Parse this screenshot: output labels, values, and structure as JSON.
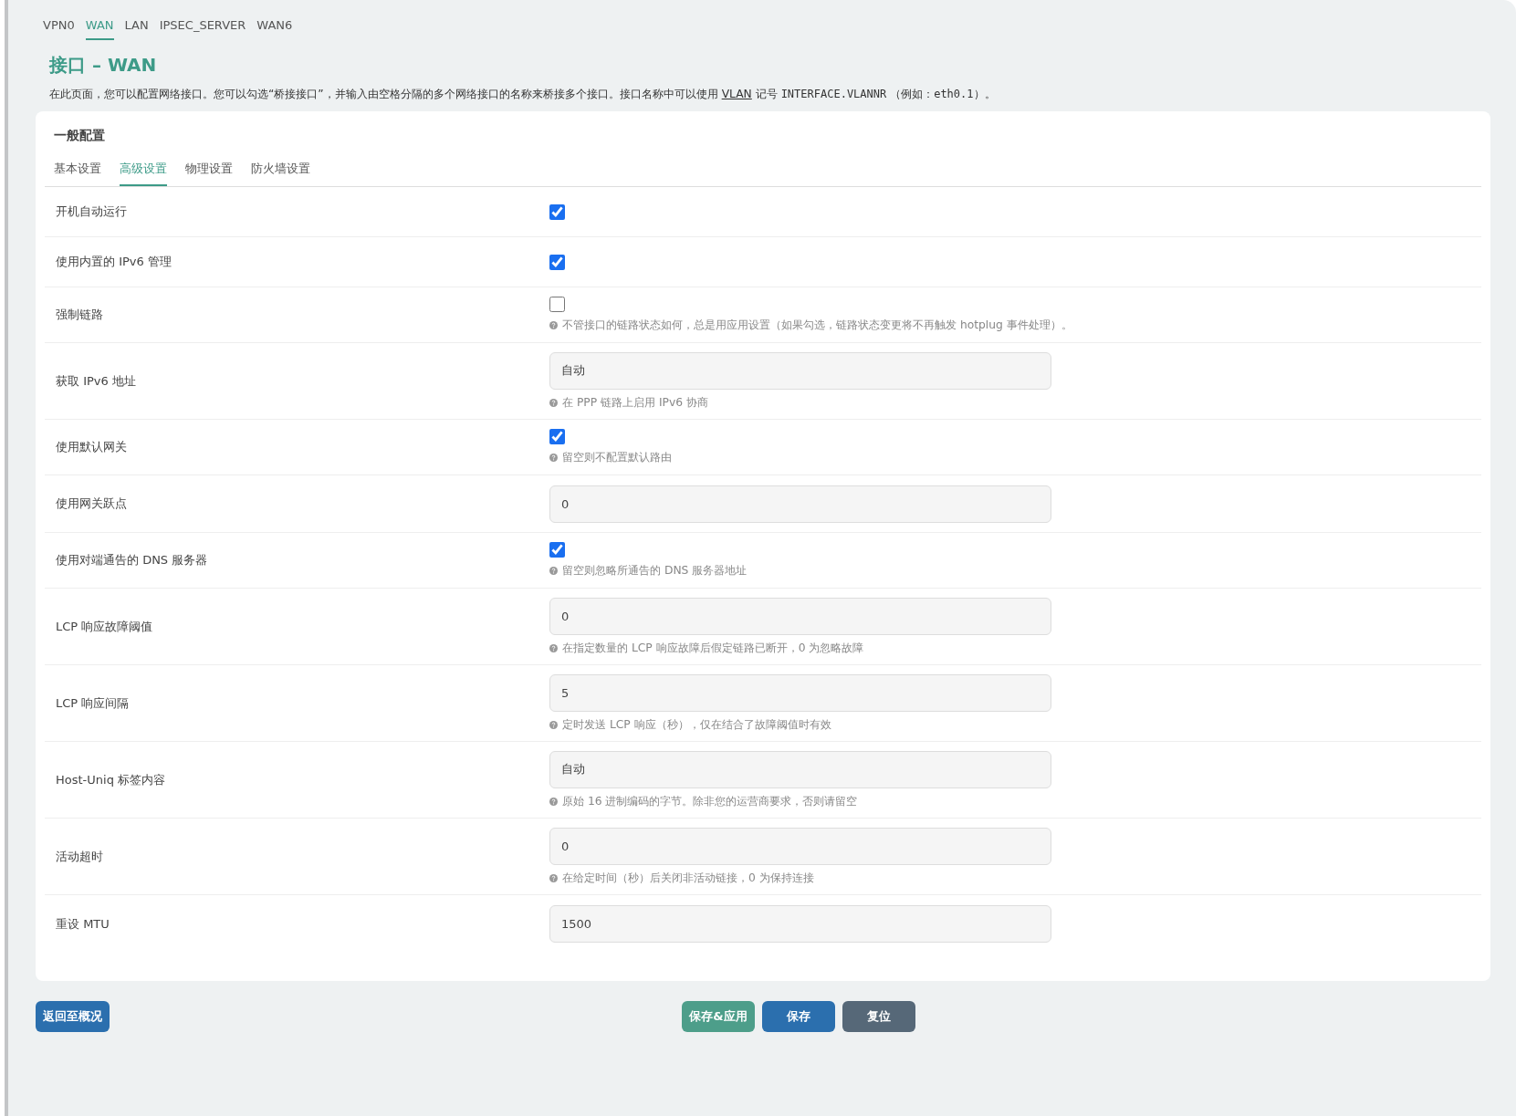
{
  "top_tabs": [
    {
      "label": "VPN0",
      "selected": false
    },
    {
      "label": "WAN",
      "selected": true
    },
    {
      "label": "LAN",
      "selected": false
    },
    {
      "label": "IPSEC_SERVER",
      "selected": false
    },
    {
      "label": "WAN6",
      "selected": false
    }
  ],
  "page": {
    "title": "接口 – WAN",
    "description": [
      {
        "kind": "text",
        "text": "在此页面，您可以配置网络接口。您可以勾选“桥接接口”，并输入由空格分隔的多个网络接口的名称来桥接多个接口。接口名称中可以使用 "
      },
      {
        "kind": "link",
        "text": "VLAN"
      },
      {
        "kind": "text",
        "text": " 记号 "
      },
      {
        "kind": "code",
        "text": "INTERFACE.VLANNR"
      },
      {
        "kind": "text",
        "text": " （例如："
      },
      {
        "kind": "code",
        "text": "eth0.1"
      },
      {
        "kind": "text",
        "text": "）。"
      }
    ]
  },
  "section": {
    "title": "一般配置",
    "tabs": [
      {
        "label": "基本设置",
        "selected": false
      },
      {
        "label": "高级设置",
        "selected": true
      },
      {
        "label": "物理设置",
        "selected": false
      },
      {
        "label": "防火墙设置",
        "selected": false
      }
    ],
    "fields": [
      {
        "kind": "checkbox",
        "label": "开机自动运行",
        "checked": true
      },
      {
        "kind": "checkbox",
        "label": "使用内置的 IPv6 管理",
        "checked": true
      },
      {
        "kind": "checkbox",
        "label": "强制链路",
        "checked": false,
        "help": "不管接口的链路状态如何，总是用应用设置（如果勾选，链路状态变更将不再触发 hotplug 事件处理）。"
      },
      {
        "kind": "input",
        "label": "获取 IPv6 地址",
        "value": "自动",
        "help": "在 PPP 链路上启用 IPv6 协商"
      },
      {
        "kind": "checkbox",
        "label": "使用默认网关",
        "checked": true,
        "help": "留空则不配置默认路由"
      },
      {
        "kind": "input",
        "label": "使用网关跃点",
        "value": "0"
      },
      {
        "kind": "checkbox",
        "label": "使用对端通告的 DNS 服务器",
        "checked": true,
        "help": "留空则忽略所通告的 DNS 服务器地址"
      },
      {
        "kind": "input",
        "label": "LCP 响应故障阈值",
        "value": "0",
        "help": "在指定数量的 LCP 响应故障后假定链路已断开，0 为忽略故障"
      },
      {
        "kind": "input",
        "label": "LCP 响应间隔",
        "value": "5",
        "help": "定时发送 LCP 响应（秒），仅在结合了故障阈值时有效"
      },
      {
        "kind": "input",
        "label": "Host-Uniq 标签内容",
        "value": "自动",
        "help": "原始 16 进制编码的字节。除非您的运营商要求，否则请留空"
      },
      {
        "kind": "input",
        "label": "活动超时",
        "value": "0",
        "help": "在给定时间（秒）后关闭非活动链接，0 为保持连接"
      },
      {
        "kind": "input",
        "label": "重设 MTU",
        "value": "1500"
      }
    ]
  },
  "footer": {
    "back_button": "返回至概况",
    "actions": [
      {
        "kind": "apply",
        "label": "保存&应用"
      },
      {
        "kind": "save",
        "label": "保存"
      },
      {
        "kind": "reset",
        "label": "复位"
      }
    ]
  }
}
